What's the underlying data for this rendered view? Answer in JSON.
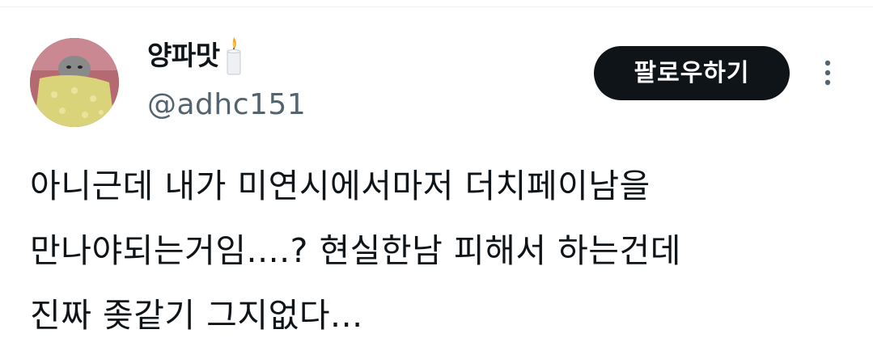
{
  "author": {
    "display_name": "양파맛",
    "name_emoji": "candle-emoji",
    "handle": "@adhc151"
  },
  "actions": {
    "follow_label": "팔로우하기",
    "more_icon": "more-vertical-icon"
  },
  "tweet": {
    "lines": [
      "아니근데 내가 미연시에서마저 더치페이남을",
      "만나야되는거임....? 현실한남 피해서 하는건데",
      "진짜 좆같기 그지없다..."
    ]
  },
  "colors": {
    "text_primary": "#0f1419",
    "text_secondary": "#536471",
    "button_bg": "#0f1419",
    "button_text": "#ffffff"
  }
}
